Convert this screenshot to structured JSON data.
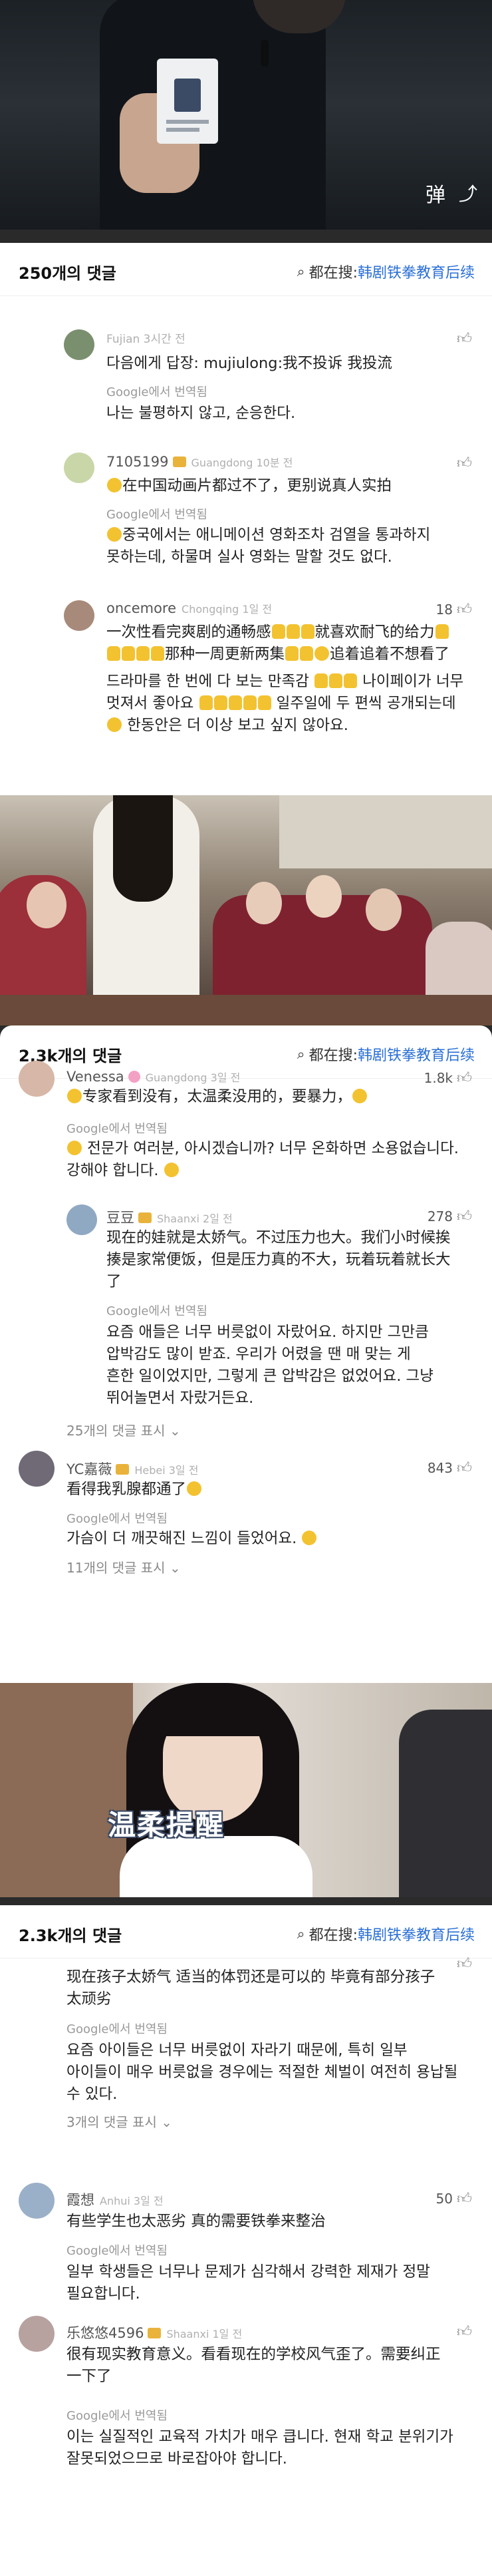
{
  "video_top": {
    "danmu_icon": "弹"
  },
  "video_mid": {},
  "video_bottom": {
    "caption": "温柔提醒"
  },
  "search_hint": {
    "prefix": "都在搜:",
    "query": "韩剧铁拳教育后续"
  },
  "section1": {
    "count": "250개의 댓글",
    "comments": [
      {
        "user": "Fujian 3시간 전",
        "reply_label": "다음에게 답장: mujiulong:我不投诉 我投流",
        "translated_by": "Google에서 번역됨",
        "translation": "나는 불평하지 않고, 순응한다."
      },
      {
        "user": "7105199",
        "meta": "Guangdong 10분 전",
        "text": "在中国动画片都过不了，更别说真人实拍",
        "translated_by": "Google에서 번역됨",
        "translation_1": "중국에서는 애니메이션 영화조차 검열을 통과하지",
        "translation_2": "못하는데, 하물며 실사 영화는 말할 것도 없다."
      },
      {
        "user": "oncemore",
        "meta": "Chongqing 1일 전",
        "likes": "18",
        "text_1": "一次性看完爽剧的通畅感",
        "text_1b": "就喜欢耐飞的给力",
        "text_2": "那种一周更新两集",
        "text_2b": "追着追着不想看了",
        "translation_1": "드라마를 한 번에 다 보는 만족감",
        "translation_1b": "나이페이가 너무",
        "translation_2": "멋져서 좋아요",
        "translation_2b": "일주일에 두 편씩 공개되는데",
        "translation_3": "한동안은 더 이상 보고 싶지 않아요."
      }
    ]
  },
  "section2": {
    "count": "2.3k개의 댓글",
    "comments": [
      {
        "user": "Venessa",
        "meta": "Guangdong 3일 전",
        "likes": "1.8k",
        "text": "专家看到没有，太温柔没用的，要暴力，",
        "translated_by": "Google에서 번역됨",
        "translation_1": "전문가 여러분, 아시겠습니까? 너무 온화하면 소용없습니다.",
        "translation_2": "강해야 합니다."
      },
      {
        "user": "豆豆",
        "meta": "Shaanxi 2일 전",
        "likes": "278",
        "text_1": "现在的娃就是太娇气。不过压力也大。我们小时候挨",
        "text_2": "揍是家常便饭，但是压力真的不大，玩着玩着就长大",
        "text_3": "了",
        "translated_by": "Google에서 번역됨",
        "translation_1": "요즘 애들은 너무 버릇없이 자랐어요. 하지만 그만큼",
        "translation_2": "압박감도 많이 받죠. 우리가 어렸을 땐 매 맞는 게",
        "translation_3": "흔한 일이었지만, 그렇게 큰 압박감은 없었어요. 그냥",
        "translation_4": "뛰어놀면서 자랐거든요.",
        "replies": "25개의 댓글 표시"
      },
      {
        "user": "YC嘉薇",
        "meta": "Hebei 3일 전",
        "likes": "843",
        "text": "看得我乳腺都通了",
        "translated_by": "Google에서 번역됨",
        "translation": "가슴이 더 깨끗해진 느낌이 들었어요.",
        "replies": "11개의 댓글 표시"
      }
    ]
  },
  "section3": {
    "count": "2.3k개의 댓글",
    "comments": [
      {
        "text_1": "现在孩子太娇气 适当的体罚还是可以的 毕竟有部分孩子",
        "text_2": "太顽劣",
        "translated_by": "Google에서 번역됨",
        "translation_1": "요즘 아이들은 너무 버릇없이 자라기 때문에, 특히 일부",
        "translation_2": "아이들이 매우 버릇없을 경우에는 적절한 체벌이 여전히 용납될",
        "translation_3": "수 있다.",
        "replies": "3개의 댓글 표시"
      },
      {
        "user": "霞想",
        "meta": "Anhui 3일 전",
        "likes": "50",
        "text": "有些学生也太恶劣 真的需要铁拳来整治",
        "translated_by": "Google에서 번역됨",
        "translation_1": "일부 학생들은 너무나 문제가 심각해서 강력한 제재가 정말",
        "translation_2": "필요합니다."
      },
      {
        "user": "乐悠悠4596",
        "meta": "Shaanxi 1일 전",
        "text_1": "很有现实教育意义。看看现在的学校风气歪了。需要纠正",
        "text_2": "一下了",
        "translated_by": "Google에서 번역됨",
        "translation_1": "이는 실질적인 교육적 가치가 매우 큽니다. 현재 학교 분위기가",
        "translation_2": "잘못되었으므로 바로잡아야 합니다."
      }
    ]
  }
}
